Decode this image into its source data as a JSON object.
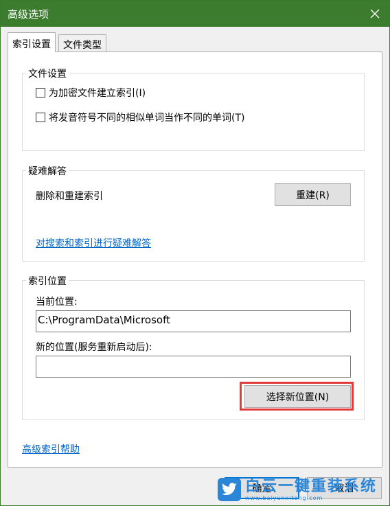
{
  "window": {
    "title": "高级选项"
  },
  "tabs": [
    {
      "label": "索引设置",
      "active": true
    },
    {
      "label": "文件类型",
      "active": false
    }
  ],
  "file_settings": {
    "group_label": "文件设置",
    "options": [
      {
        "label": "为加密文件建立索引(I)",
        "checked": false
      },
      {
        "label": "将发音符号不同的相似单词当作不同的单词(T)",
        "checked": false
      }
    ]
  },
  "troubleshoot": {
    "group_label": "疑难解答",
    "rebuild_text": "删除和重建索引",
    "rebuild_button": "重建(R)",
    "link": "对搜索和索引进行疑难解答"
  },
  "index_location": {
    "group_label": "索引位置",
    "current_label": "当前位置:",
    "current_value": "C:\\ProgramData\\Microsoft",
    "new_label": "新的位置(服务重新启动后):",
    "new_value": "",
    "select_button": "选择新位置(N)",
    "highlight_color": "#e33b3b"
  },
  "help_link": "高级索引帮助",
  "footer": {
    "ok": "确定",
    "cancel": "取消"
  },
  "watermark": {
    "text": "白云一键重装系统",
    "url": "www.baiyunxitong.com"
  }
}
